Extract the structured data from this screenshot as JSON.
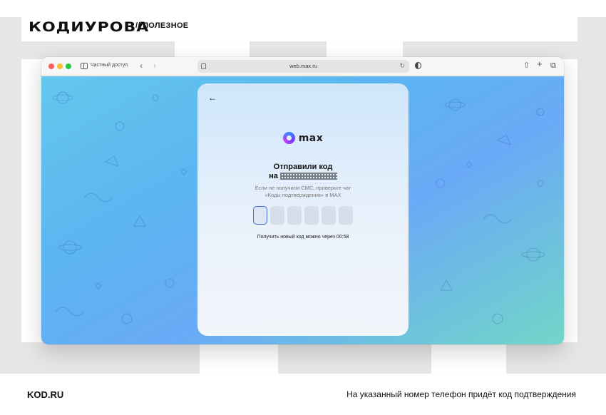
{
  "header": {
    "logo_text": "КОДИУРОВА",
    "section_tag": "// ПОЛЕЗНОЕ"
  },
  "browser": {
    "private_label": "Частный доступ",
    "url": "web.max.ru",
    "icons": {
      "back": "chevron-left-icon",
      "forward": "chevron-right-icon",
      "sidebar": "sidebar-icon",
      "reload": "reload-icon",
      "shield": "shield-icon",
      "share": "share-icon",
      "new_tab": "plus-icon",
      "tabs": "tabs-icon"
    }
  },
  "page": {
    "brand_name": "max",
    "title": "Отправили код",
    "phone_prefix": "на",
    "hint_line1": "Если не получили СМС, проверьте чат",
    "hint_line2": "«Коды подтверждения» в MAX",
    "code_length": 6,
    "resend_timer": "Получить новый код можно через 00:58"
  },
  "footer": {
    "site": "KOD.RU",
    "caption": "На указанный номер телефон придёт код подтверждения"
  },
  "colors": {
    "background_gradient_start": "#64c8ee",
    "background_gradient_end": "#72d6c8",
    "active_box_border": "#3a6ad0"
  }
}
